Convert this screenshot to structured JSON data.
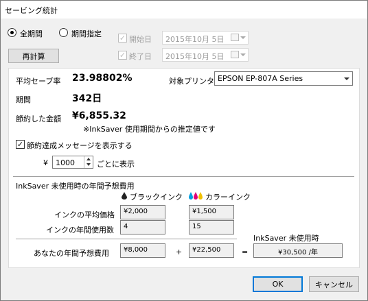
{
  "window": {
    "title": "セービング統計"
  },
  "period_options": {
    "all_label": "全期間",
    "custom_label": "期間指定",
    "selected": "all",
    "start_label": "開始日",
    "start_value": "2015年10月  5日",
    "end_label": "終了日",
    "end_value": "2015年10月  5日"
  },
  "buttons": {
    "recalc": "再計算",
    "ok": "OK",
    "cancel": "キャンセル"
  },
  "stats": {
    "saving_rate_label": "平均セーブ率",
    "saving_rate_value": "23.98802%",
    "period_label": "期間",
    "period_value": "342日",
    "saved_amount_label": "節約した金額",
    "saved_amount_value": "¥6,855.32",
    "note": "※InkSaver 使用期間からの推定値です"
  },
  "printer": {
    "label": "対象プリンタ",
    "selected": "EPSON EP-807A Series"
  },
  "message": {
    "checkbox_label": "節約達成メッセージを表示する",
    "checked": true,
    "currency": "¥",
    "interval_value": "1000",
    "suffix": "ごとに表示"
  },
  "estimate": {
    "section_title": "InkSaver 未使用時の年間予想費用",
    "black_header": "ブラックインク",
    "color_header": "カラーインク",
    "avg_price_label": "インクの平均価格",
    "black_avg_price": "¥2,000",
    "color_avg_price": "¥1,500",
    "annual_count_label": "インクの年間使用数",
    "black_count": "4",
    "color_count": "15",
    "without_label": "InkSaver 未使用時",
    "annual_cost_label": "あなたの年間予想費用",
    "black_cost": "¥8,000",
    "plus": "+",
    "color_cost": "¥22,500",
    "equals": "=",
    "total_cost": "¥30,500 /年"
  },
  "colors": {
    "accent": "#0078d7",
    "ink_cyan": "#00a0e0",
    "ink_magenta": "#e0007a",
    "ink_yellow": "#f0c000"
  }
}
